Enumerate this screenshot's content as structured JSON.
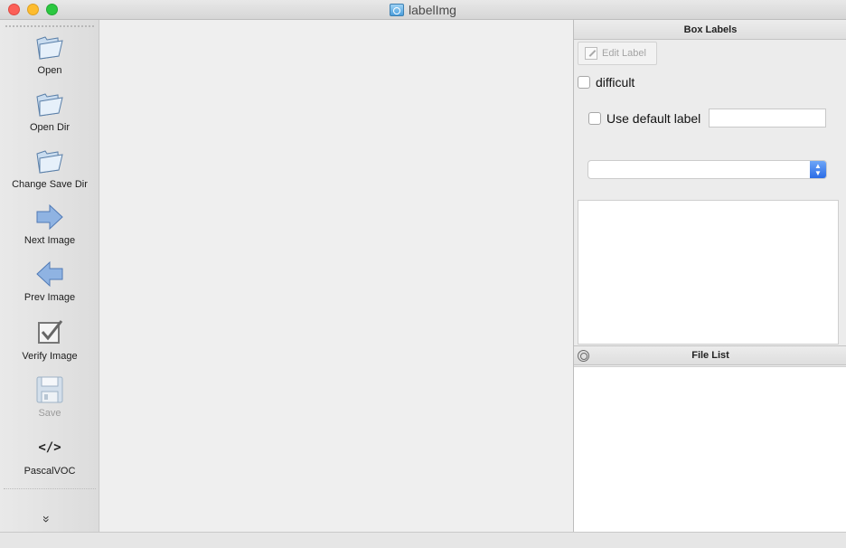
{
  "window": {
    "title": "labelImg"
  },
  "toolbar": {
    "items": [
      {
        "label": "Open",
        "icon": "folder-open-icon",
        "enabled": true
      },
      {
        "label": "Open Dir",
        "icon": "folder-open-icon",
        "enabled": true
      },
      {
        "label": "Change Save Dir",
        "icon": "folder-open-icon",
        "enabled": true
      },
      {
        "label": "Next Image",
        "icon": "arrow-right-icon",
        "enabled": true
      },
      {
        "label": "Prev Image",
        "icon": "arrow-left-icon",
        "enabled": true
      },
      {
        "label": "Verify Image",
        "icon": "checkbox-icon",
        "enabled": true
      },
      {
        "label": "Save",
        "icon": "floppy-disk-icon",
        "enabled": false
      },
      {
        "label": "PascalVOC",
        "icon": "code-brackets-icon",
        "glyph": "</>",
        "enabled": true
      }
    ],
    "more_glyph": "»"
  },
  "box_labels": {
    "title": "Box Labels",
    "edit_label_button": "Edit Label",
    "difficult_label": "difficult",
    "difficult_checked": false,
    "use_default_label": "Use default label",
    "use_default_checked": false,
    "default_label_value": "",
    "label_combo_value": "",
    "label_items": []
  },
  "file_list": {
    "title": "File List",
    "items": []
  },
  "colors": {
    "accent": "#2b6ce6",
    "close": "#fc5f57",
    "minimize": "#fdbc2e",
    "maximize": "#2bc840"
  }
}
